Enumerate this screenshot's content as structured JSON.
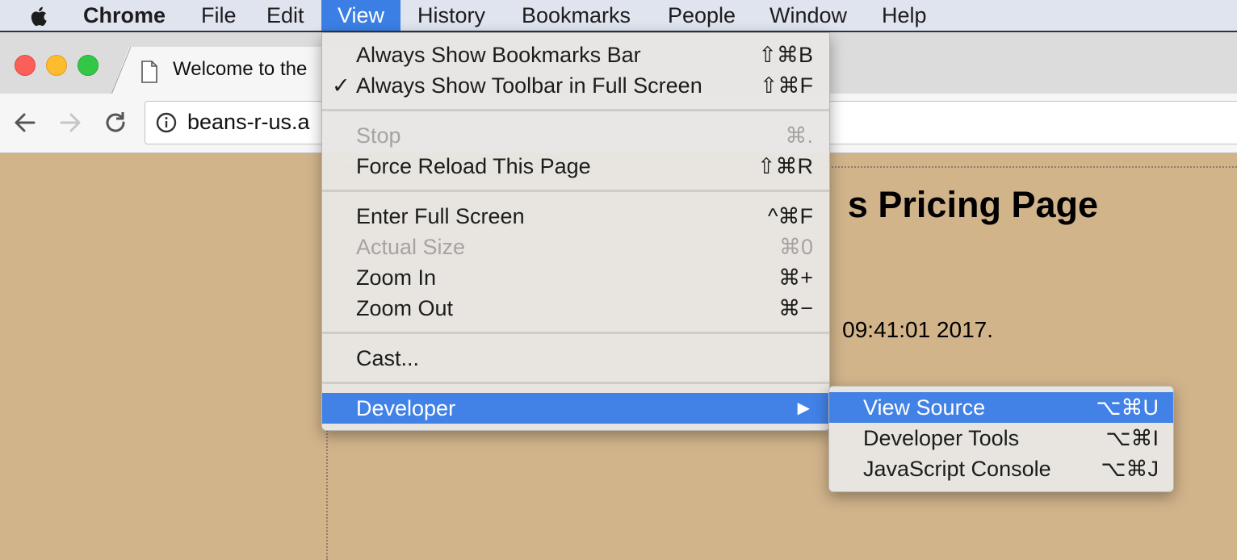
{
  "menubar": {
    "app_name": "Chrome",
    "items": [
      "File",
      "Edit",
      "View",
      "History",
      "Bookmarks",
      "People",
      "Window",
      "Help"
    ],
    "active_item": "View"
  },
  "tab": {
    "title": "Welcome to the"
  },
  "omnibox": {
    "url": "beans-r-us.a"
  },
  "page": {
    "heading": "s Pricing Page",
    "text": "09:41:01 2017."
  },
  "view_menu": {
    "groups": [
      [
        {
          "label": "Always Show Bookmarks Bar",
          "shortcut": "⇧⌘B",
          "checked": false,
          "enabled": true
        },
        {
          "label": "Always Show Toolbar in Full Screen",
          "shortcut": "⇧⌘F",
          "checked": true,
          "enabled": true
        }
      ],
      [
        {
          "label": "Stop",
          "shortcut": "⌘.",
          "enabled": false
        },
        {
          "label": "Force Reload This Page",
          "shortcut": "⇧⌘R",
          "enabled": true
        }
      ],
      [
        {
          "label": "Enter Full Screen",
          "shortcut": "^⌘F",
          "enabled": true
        },
        {
          "label": "Actual Size",
          "shortcut": "⌘0",
          "enabled": false
        },
        {
          "label": "Zoom In",
          "shortcut": "⌘+",
          "enabled": true
        },
        {
          "label": "Zoom Out",
          "shortcut": "⌘−",
          "enabled": true
        }
      ],
      [
        {
          "label": "Cast...",
          "shortcut": "",
          "enabled": true
        }
      ],
      [
        {
          "label": "Developer",
          "shortcut": "",
          "enabled": true,
          "submenu": true,
          "highlighted": true
        }
      ]
    ]
  },
  "developer_menu": {
    "items": [
      {
        "label": "View Source",
        "shortcut": "⌥⌘U",
        "highlighted": true
      },
      {
        "label": "Developer Tools",
        "shortcut": "⌥⌘I"
      },
      {
        "label": "JavaScript Console",
        "shortcut": "⌥⌘J"
      }
    ]
  }
}
